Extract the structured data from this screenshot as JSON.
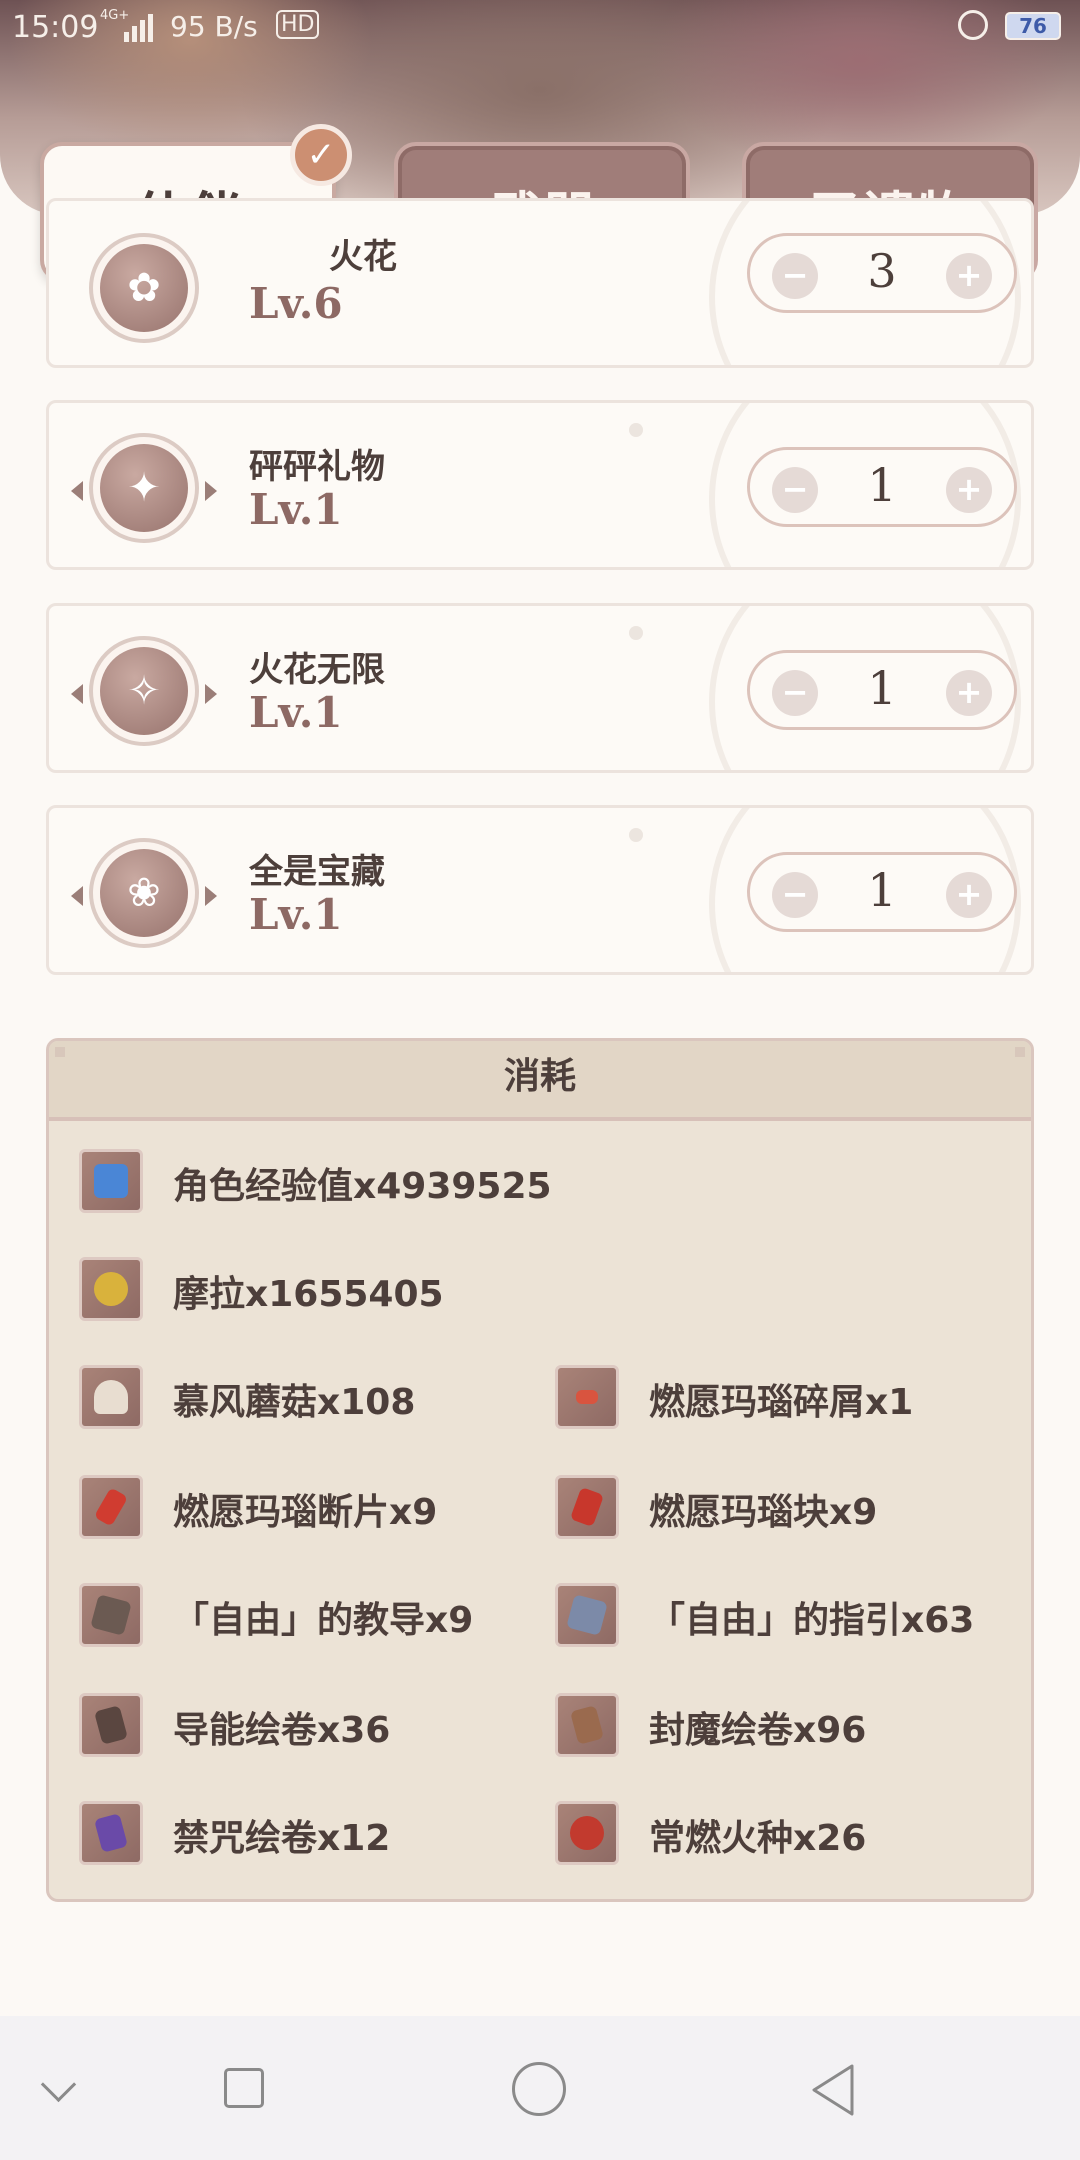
{
  "status_bar": {
    "time": "15:09",
    "network": "4G+",
    "speed": "95 B/s",
    "hd": "HD",
    "battery": "76"
  },
  "tabs": [
    {
      "label": "伙伴",
      "active": true
    },
    {
      "label": "武器",
      "active": false
    },
    {
      "label": "圣遗物",
      "active": false
    }
  ],
  "talents": [
    {
      "name": "火花",
      "level": "Lv.6",
      "count": "3",
      "icon": "flower-talent-icon"
    },
    {
      "name": "砰砰礼物",
      "level": "Lv.1",
      "count": "1",
      "icon": "bomb-talent-icon"
    },
    {
      "name": "火花无限",
      "level": "Lv.1",
      "count": "1",
      "icon": "spark-talent-icon"
    },
    {
      "name": "全是宝藏",
      "level": "Lv.1",
      "count": "1",
      "icon": "treasure-bag-talent-icon"
    }
  ],
  "stepper": {
    "minus": "−",
    "plus": "+"
  },
  "consumption": {
    "title": "消耗",
    "items": [
      {
        "label": "角色经验值x4939525",
        "icon": "exp-book-icon",
        "color": "#4a86d6"
      },
      {
        "label": "摩拉x1655405",
        "icon": "mora-coin-icon",
        "color": "#d9b23c"
      },
      {
        "label": "慕风蘑菇x108",
        "icon": "mushroom-icon",
        "color": "#e8ddd0"
      },
      {
        "label": "燃愿玛瑙碎屑x1",
        "icon": "agate-sliver-icon",
        "color": "#d9543f"
      },
      {
        "label": "燃愿玛瑙断片x9",
        "icon": "agate-fragment-icon",
        "color": "#d03c30"
      },
      {
        "label": "燃愿玛瑙块x9",
        "icon": "agate-chunk-icon",
        "color": "#c8372c"
      },
      {
        "label": "「自由」的教导x9",
        "icon": "freedom-teachings-icon",
        "color": "#6b5a52"
      },
      {
        "label": "「自由」的指引x63",
        "icon": "freedom-guide-icon",
        "color": "#7c8aa8"
      },
      {
        "label": "导能绘卷x36",
        "icon": "divining-scroll-icon",
        "color": "#5a4640"
      },
      {
        "label": "封魔绘卷x96",
        "icon": "sealed-scroll-icon",
        "color": "#9a6a4e"
      },
      {
        "label": "禁咒绘卷x12",
        "icon": "forbidden-scroll-icon",
        "color": "#6a4aa8"
      },
      {
        "label": "常燃火种x26",
        "icon": "everflame-seed-icon",
        "color": "#c23a2e"
      }
    ]
  }
}
